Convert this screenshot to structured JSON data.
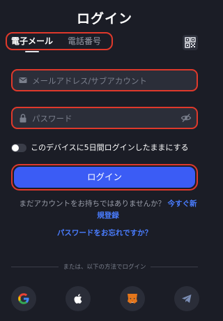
{
  "header": {
    "title": "ログイン"
  },
  "tabs": [
    {
      "label": "電子メール",
      "active": true
    },
    {
      "label": "電話番号",
      "active": false
    }
  ],
  "qr_button": {
    "icon": "qr-code-icon"
  },
  "form": {
    "email": {
      "placeholder": "メールアドレス/サブアカウント",
      "value": "",
      "icon": "mail-icon"
    },
    "password": {
      "placeholder": "パスワード",
      "value": "",
      "icon": "lock-icon",
      "toggle_icon": "eye-off-icon"
    },
    "remember": {
      "label": "このデバイスに5日間ログインしたままにする",
      "checked": false
    },
    "submit_label": "ログイン"
  },
  "signup": {
    "prompt": "まだアカウントをお持ちではありませんか？",
    "link": "今すぐ新規登録"
  },
  "forgot_password": "パスワードをお忘れですか？",
  "divider_text": "または、以下の方法でログイン",
  "social": [
    {
      "name": "Google",
      "icon": "google-icon"
    },
    {
      "name": "Apple",
      "icon": "apple-icon"
    },
    {
      "name": "MetaMask",
      "icon": "metamask-icon"
    },
    {
      "name": "Telegram",
      "icon": "telegram-icon"
    }
  ],
  "colors": {
    "background": "#1b1d26",
    "accent": "#3b5cf5",
    "link": "#4a7dff",
    "highlight_outline": "#e0392b",
    "field_bg": "#2b2e39"
  }
}
